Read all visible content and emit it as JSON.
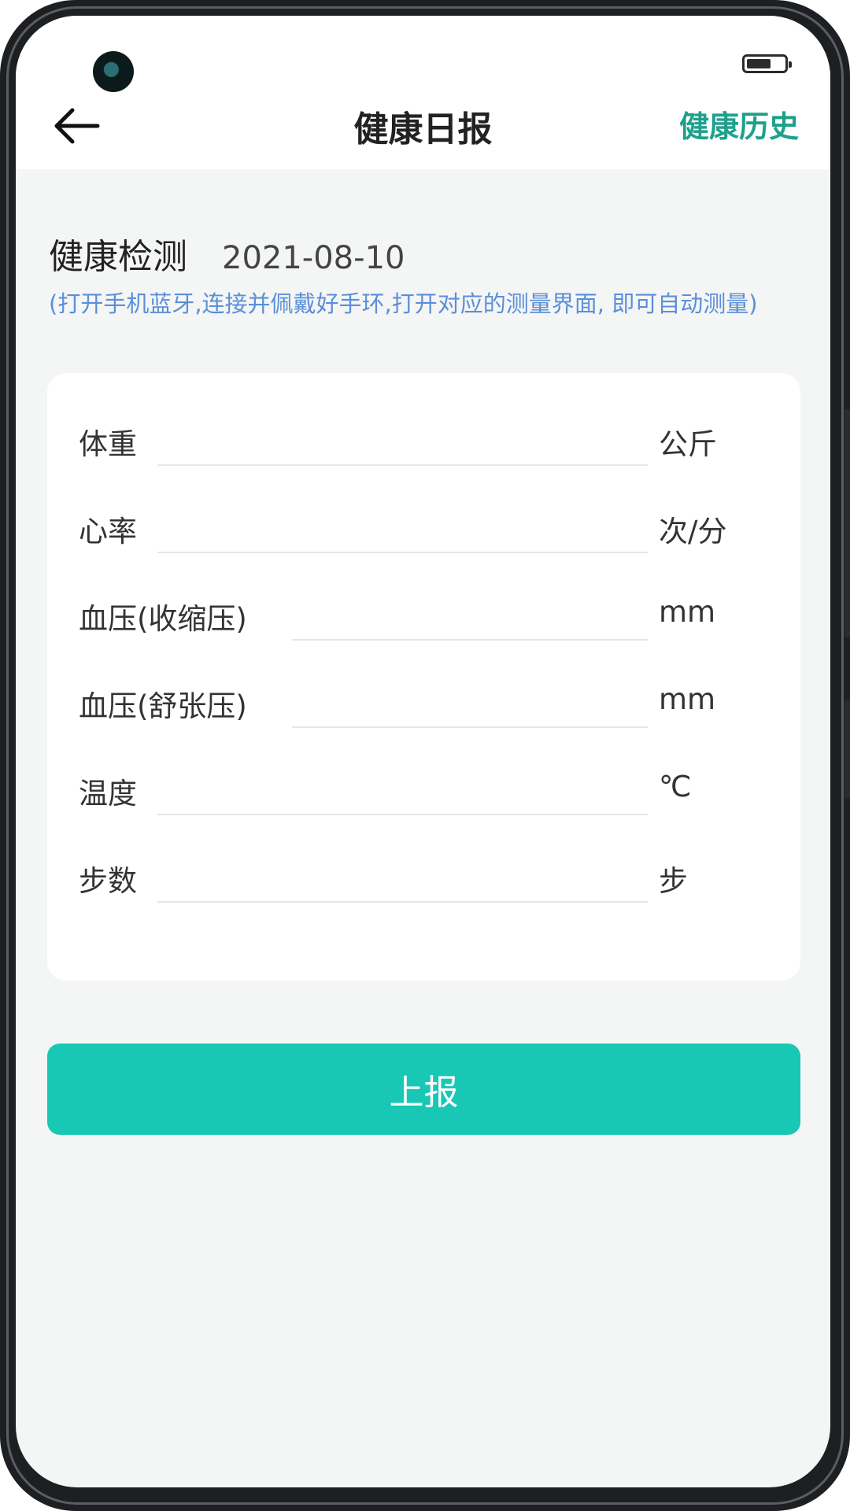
{
  "header": {
    "title": "健康日报",
    "history_link": "健康历史"
  },
  "section": {
    "title": "健康检测",
    "date": "2021-08-10",
    "hint": "(打开手机蓝牙,连接并佩戴好手环,打开对应的测量界面, 即可自动测量)"
  },
  "form": {
    "rows": [
      {
        "label": "体重",
        "unit": "公斤",
        "value": ""
      },
      {
        "label": "心率",
        "unit": "次/分",
        "value": ""
      },
      {
        "label": "血压(收缩压)",
        "unit": "mm",
        "value": ""
      },
      {
        "label": "血压(舒张压)",
        "unit": "mm",
        "value": ""
      },
      {
        "label": "温度",
        "unit": "℃",
        "value": ""
      },
      {
        "label": "步数",
        "unit": "步",
        "value": ""
      }
    ]
  },
  "submit_label": "上报",
  "colors": {
    "accent": "#18c8b4",
    "link": "#1fa08c",
    "hint": "#5b8fd9",
    "background": "#f4f5f5"
  },
  "icons": {
    "back": "arrow-left-icon",
    "battery": "battery-icon",
    "camera": "front-camera"
  }
}
